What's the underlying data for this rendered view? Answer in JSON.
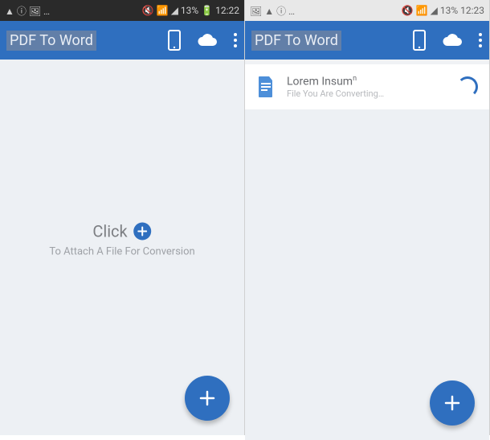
{
  "left_screen": {
    "status": {
      "left_icons": "▲ ⓘ 🖼 …",
      "right": "🔇 📶 ◢ 13% 🔋 12:22"
    },
    "appbar": {
      "title": "PDF To Word"
    },
    "prompt": {
      "click": "Click",
      "subtitle": "To Attach A File For Conversion"
    }
  },
  "right_screen": {
    "status": {
      "left_icons": "🖼 ▲ ⓘ …",
      "right": "🔇 📶 ◢ 13% 12:23"
    },
    "appbar": {
      "title": "PDF To Word"
    },
    "item": {
      "title": "Lorem Insum",
      "title_sup": "n",
      "sub": "File You Are Converting…"
    }
  },
  "colors": {
    "accent": "#2f6fbf"
  }
}
